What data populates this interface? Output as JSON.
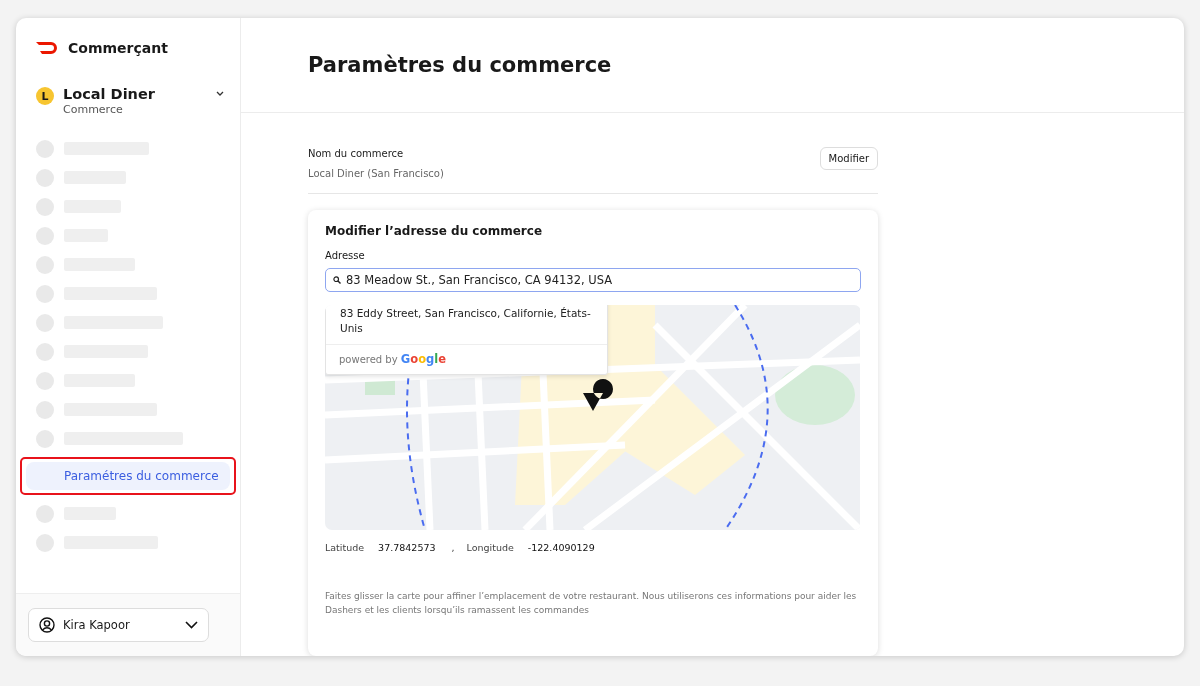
{
  "sidebar": {
    "brand": "Commerçant",
    "store": {
      "initial": "L",
      "name": "Local Diner",
      "type": "Commerce"
    },
    "items": [
      {
        "kind": "skeleton",
        "selected": false
      },
      {
        "kind": "skeleton",
        "selected": false
      },
      {
        "kind": "skeleton",
        "selected": false
      },
      {
        "kind": "skeleton",
        "selected": false
      },
      {
        "kind": "skeleton",
        "selected": false
      },
      {
        "kind": "skeleton",
        "selected": false
      },
      {
        "kind": "skeleton",
        "selected": false
      },
      {
        "kind": "skeleton",
        "selected": false
      },
      {
        "kind": "skeleton",
        "selected": false
      },
      {
        "kind": "skeleton",
        "selected": false
      },
      {
        "kind": "skeleton",
        "selected": false
      },
      {
        "kind": "link",
        "label": "Paramétres du commerce",
        "selected": true
      },
      {
        "kind": "skeleton",
        "selected": false
      },
      {
        "kind": "skeleton",
        "selected": false
      }
    ],
    "user": {
      "name": "Kira Kapoor"
    }
  },
  "page": {
    "title": "Paramètres du commerce"
  },
  "store_name": {
    "label": "Nom du commerce",
    "value": "Local Diner (San Francisco)",
    "button": "Modifier"
  },
  "address_card": {
    "title": "Modifier l’adresse du commerce",
    "field_label": "Adresse",
    "value": "83 Meadow St., San Francisco, CA 94132, USA",
    "suggestions": [
      {
        "text": "83 Eddy Street, San Francisco, Californie, États-Unis"
      }
    ],
    "attribution": {
      "prefix": "powered by",
      "brand": "Google"
    },
    "latitude_label": "Latitude",
    "latitude": "37.7842573",
    "separator": ",",
    "longitude_label": "Longitude",
    "longitude": "-122.4090129",
    "hint": "Faites glisser la carte pour affiner l’emplacement de votre restaurant. Nous utiliserons ces informations pour aider les Dashers et les clients lorsqu’ils ramassent les commandes"
  }
}
